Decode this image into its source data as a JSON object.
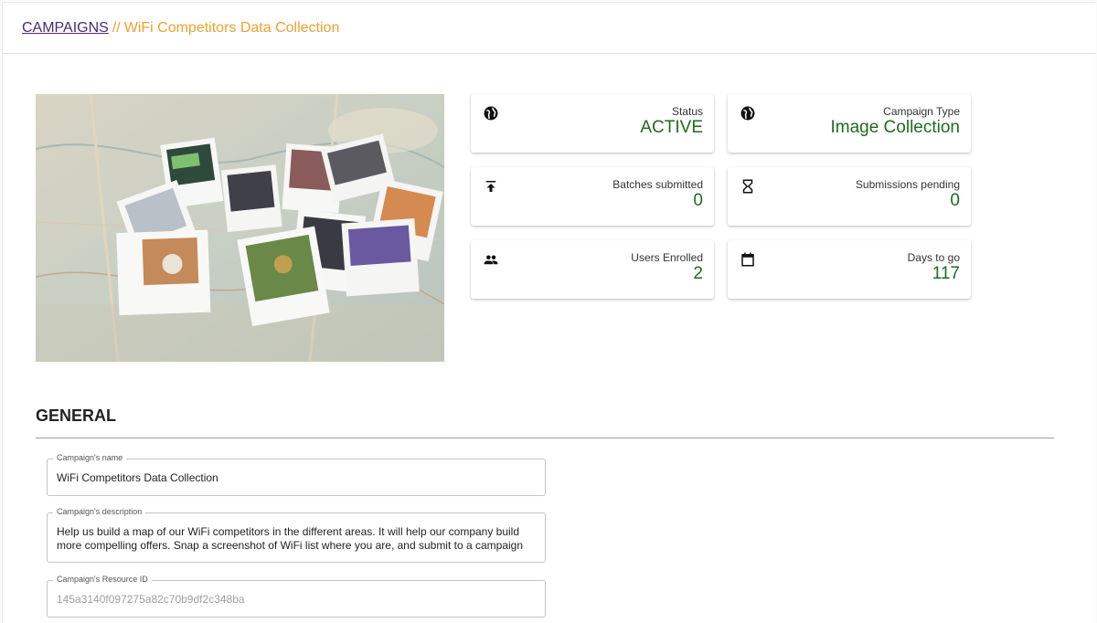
{
  "breadcrumb": {
    "root": "CAMPAIGNS",
    "separator": "//",
    "current": "WiFi Competitors Data Collection"
  },
  "stats": {
    "status": {
      "label": "Status",
      "value": "ACTIVE",
      "icon": "globe-icon"
    },
    "campaign_type": {
      "label": "Campaign Type",
      "value": "Image Collection",
      "icon": "globe-icon"
    },
    "batches_submitted": {
      "label": "Batches submitted",
      "value": "0",
      "icon": "upload-icon"
    },
    "submissions_pending": {
      "label": "Submissions pending",
      "value": "0",
      "icon": "hourglass-icon"
    },
    "users_enrolled": {
      "label": "Users Enrolled",
      "value": "2",
      "icon": "people-icon"
    },
    "days_to_go": {
      "label": "Days to go",
      "value": "117",
      "icon": "calendar-icon"
    }
  },
  "general": {
    "title": "GENERAL",
    "name_field": {
      "label": "Campaign's name",
      "value": "WiFi Competitors Data Collection"
    },
    "description_field": {
      "label": "Campaign's description",
      "line1": "Help us build a map of our WiFi competitors in the different areas. It will help our company build",
      "line2": "more compelling offers. Snap a screenshot of WiFi list where you are, and submit to a campaign"
    },
    "resource_field": {
      "label": "Campaign's Resource ID",
      "value": "145a3140f097275a82c70b9df2c348ba"
    }
  },
  "colors": {
    "accent_orange": "#f0a030",
    "link_purple": "#4a2a7a",
    "value_green": "#1e6b1e"
  }
}
